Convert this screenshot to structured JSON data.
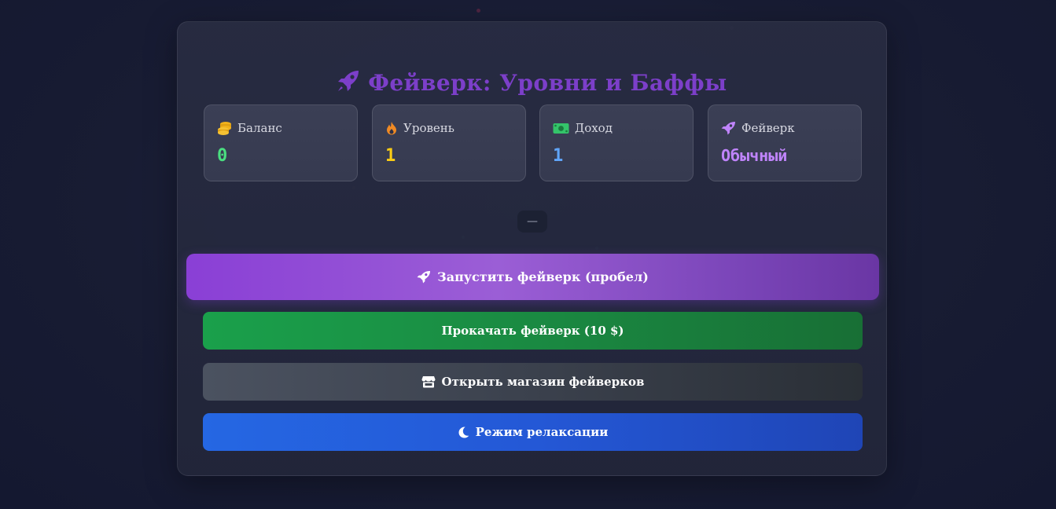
{
  "title": {
    "icon": "rocket-icon",
    "text": "Фейверк: Уровни и Баффы"
  },
  "stats": [
    {
      "icon": "coins-icon",
      "label": "Баланс",
      "value": "0",
      "color": "#4ade80"
    },
    {
      "icon": "fire-icon",
      "label": "Уровень",
      "value": "1",
      "color": "#facc15"
    },
    {
      "icon": "money-icon",
      "label": "Доход",
      "value": "1",
      "color": "#60a5fa"
    },
    {
      "icon": "rocket-icon",
      "label": "Фейверк",
      "value": "Обычный",
      "color": "#c084fc"
    }
  ],
  "status_indicator": "—",
  "buttons": {
    "launch": {
      "icon": "rocket-icon",
      "label": "Запустить фейверк (пробел)"
    },
    "upgrade": {
      "label": "Прокачать фейверк (10 $)"
    },
    "shop": {
      "icon": "store-icon",
      "label": "Открыть магазин фейверков"
    },
    "relax": {
      "icon": "moon-icon",
      "label": "Режим релаксации"
    }
  },
  "colors": {
    "title": "#7c3fc9",
    "launch": "#8a3fd6",
    "upgrade": "#1aa04b",
    "shop": "#4b5260",
    "relax": "#2567e3"
  }
}
